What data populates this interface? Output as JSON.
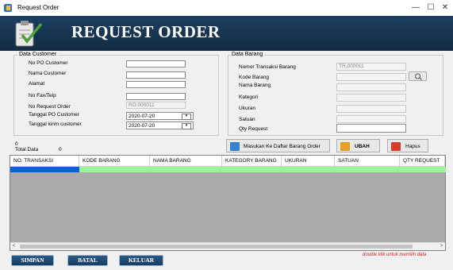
{
  "window": {
    "title": "Request Order",
    "minimize": "—",
    "maximize": "☐",
    "close": "✕"
  },
  "banner": {
    "title": "REQUEST ORDER"
  },
  "customer": {
    "group_title": "Data Customer",
    "po_label": "No PO Customer",
    "name_label": "Nama Customer",
    "address_label": "Alamat",
    "fax_label": "No Fax/Telp",
    "request_label": "No Request Order",
    "request_value": "RO.000011",
    "po_date_label": "Tanggal PO Customer",
    "po_date_value": "2020-07-20",
    "ship_date_label": "Tanggal kirim customer",
    "ship_date_value": "2020-07-20"
  },
  "barang": {
    "group_title": "Data Barang",
    "trans_label": "Nomor Transaksi Barang",
    "trans_value": "TR.000011",
    "kode_label": "Kode Barang",
    "nama_label": "Nama Barang",
    "kategori_label": "Kategori",
    "ukuran_label": "Ukuran",
    "satuan_label": "Satuan",
    "qty_label": "Qty Request"
  },
  "actions": {
    "add_label": "Masukan Ke Daftar Barang Order",
    "ubah_label": "UBAH",
    "hapus_label": "Hapus"
  },
  "totals": {
    "top_value": "0",
    "label": "Total Data",
    "count": "0"
  },
  "grid": {
    "columns": [
      "NO. TRANSAKSI",
      "KODE BARANG",
      "NAMA BARANG",
      "KATEGORY BARANG",
      "UKURAN",
      "SATUAN",
      "QTY REQUEST"
    ],
    "scroll_left": "<",
    "scroll_right": ">"
  },
  "bottom": {
    "simpan": "SIMPAN",
    "batal": "BATAL",
    "keluar": "KELUAR",
    "hint": "double klik untuk memilih data"
  },
  "colors": {
    "banner": "#1c3f5f",
    "selected": "#0c5fd6",
    "new_row": "#98f498",
    "hint": "#dd2222"
  }
}
